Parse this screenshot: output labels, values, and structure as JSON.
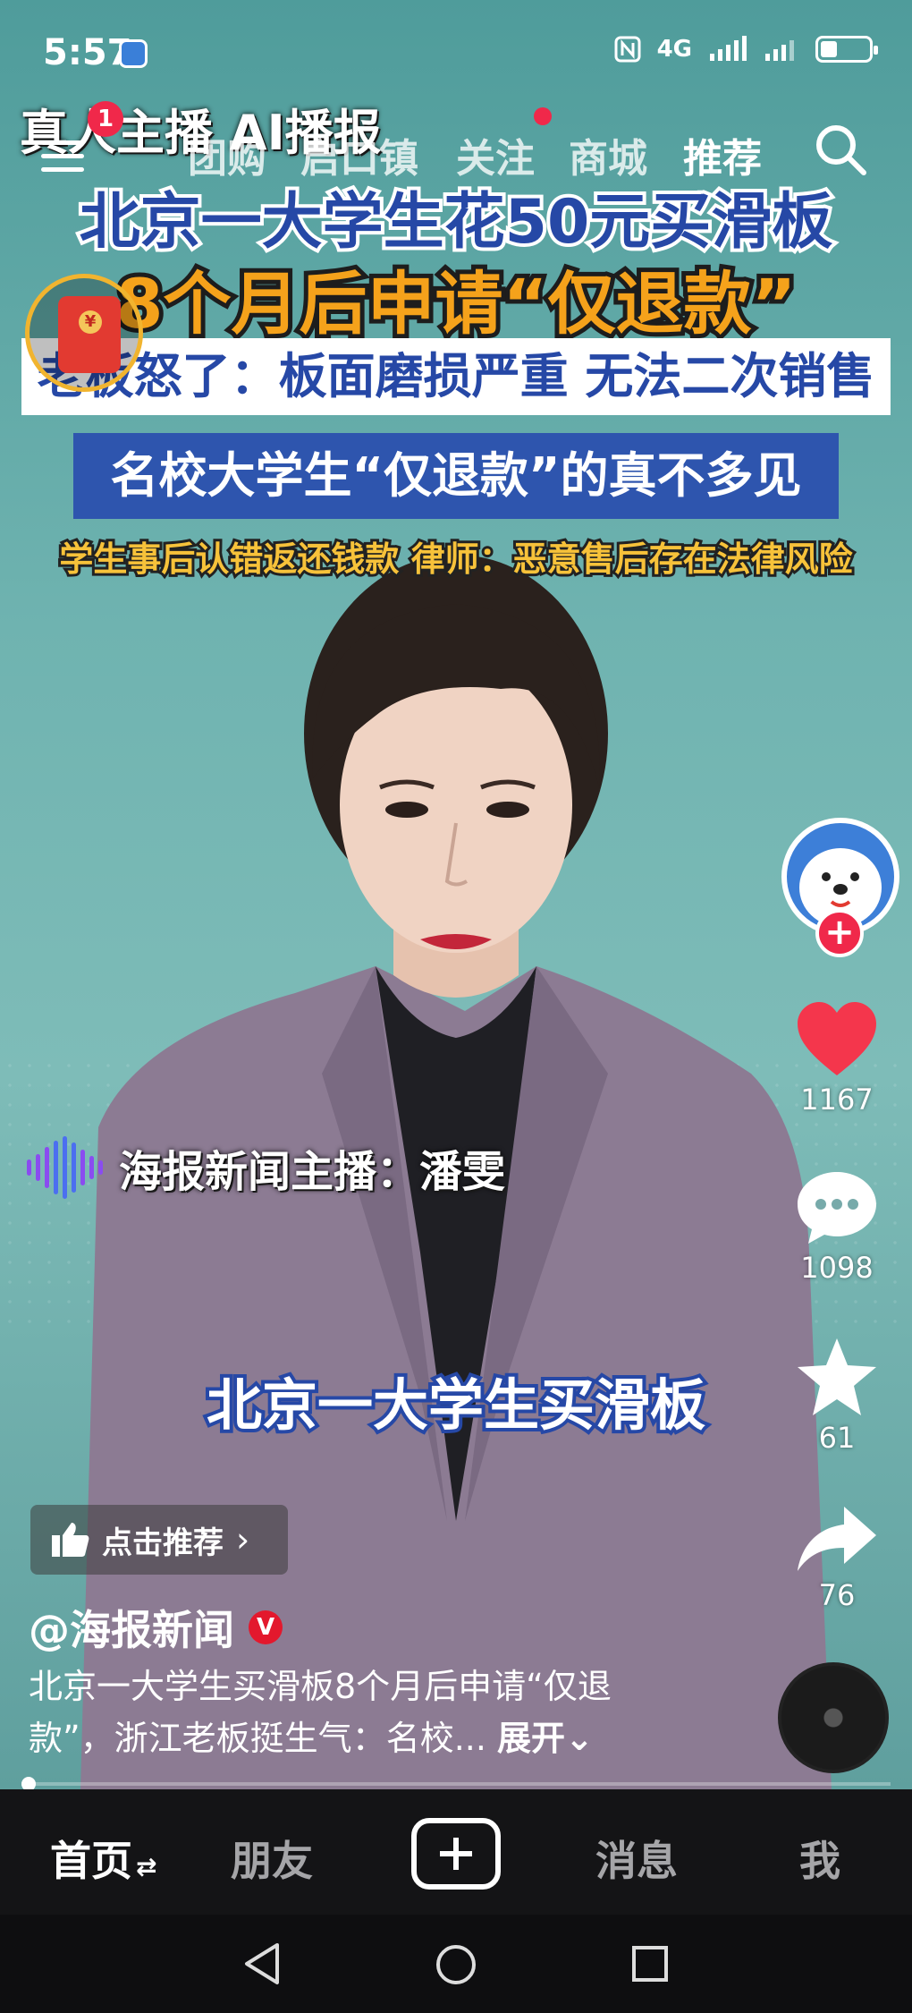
{
  "status_bar": {
    "time": "5:57",
    "network": "4G",
    "icons": [
      "nfc-icon",
      "signal-icon",
      "signal-icon",
      "battery-icon"
    ]
  },
  "overlay_title": "真人主播 AI播报",
  "top_nav": {
    "badge_count": "1",
    "tabs": [
      "团购",
      "启口镇",
      "关注",
      "商城",
      "推荐"
    ],
    "active_tab": "推荐"
  },
  "headline": {
    "line1": "北京一大学生花50元买滑板",
    "line2": "8个月后申请“仅退款”",
    "line3": "老板怒了：板面磨损严重 无法二次销售",
    "line4": "名校大学生“仅退款”的真不多见",
    "line5": "学生事后认错返还钱款 律师：恶意售后存在法律风险"
  },
  "anchor_name": "海报新闻主播：潘雯",
  "subtitle": "北京一大学生买滑板",
  "side_actions": {
    "likes": "1167",
    "comments": "1098",
    "favorites": "61",
    "shares": "76"
  },
  "recommend_button": "点击推荐",
  "author": "@海报新闻",
  "verified_badge": "V",
  "description": "北京一大学生买滑板8个月后申请“仅退款”，浙江老板挺生气：名校...",
  "expand_label": "展开",
  "bottom_tabs": {
    "home": "首页",
    "friends": "朋友",
    "messages": "消息",
    "me": "我"
  },
  "colors": {
    "accent_red": "#f0284a",
    "headline_blue": "#2648a6",
    "headline_orange": "#f5a21b",
    "video_bg": "#6fb3b0"
  }
}
